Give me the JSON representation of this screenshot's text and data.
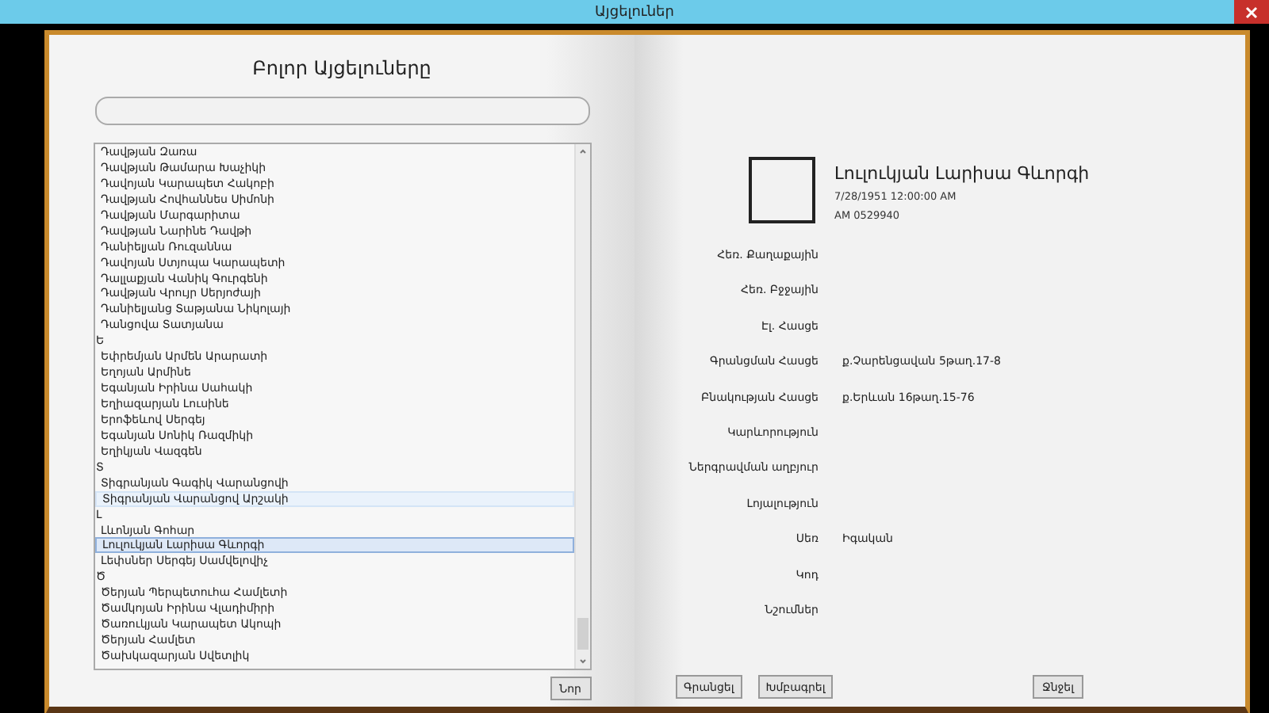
{
  "window": {
    "title": "Այցելուներ"
  },
  "left_page": {
    "heading": "Բոլոր Այցելուները",
    "list": [
      {
        "kind": "entry",
        "text": "Դավթյան Զառա",
        "selected": false,
        "highlighted": false
      },
      {
        "kind": "entry",
        "text": "Դավթյան Թամարա Խաչիկի",
        "selected": false,
        "highlighted": false
      },
      {
        "kind": "entry",
        "text": "Դավոյան Կարապետ Հակոբի",
        "selected": false,
        "highlighted": false
      },
      {
        "kind": "entry",
        "text": "Դավթյան Հովհաննես Սիմոնի",
        "selected": false,
        "highlighted": false
      },
      {
        "kind": "entry",
        "text": "Դավթյան Մարգարիտա",
        "selected": false,
        "highlighted": false
      },
      {
        "kind": "entry",
        "text": "Դավթյան Նարինե Դավթի",
        "selected": false,
        "highlighted": false
      },
      {
        "kind": "entry",
        "text": "Դանիելյան Ռուզաննա",
        "selected": false,
        "highlighted": false
      },
      {
        "kind": "entry",
        "text": "Դավոյան Ստյոպա Կարապետի",
        "selected": false,
        "highlighted": false
      },
      {
        "kind": "entry",
        "text": "Դալլաքյան Վանիկ Գուրգենի",
        "selected": false,
        "highlighted": false
      },
      {
        "kind": "entry",
        "text": "Դավթյան Վրույր Սերյոժայի",
        "selected": false,
        "highlighted": false
      },
      {
        "kind": "entry",
        "text": "Դանիելյանց Տաթյանա Նիկոլայի",
        "selected": false,
        "highlighted": false
      },
      {
        "kind": "entry",
        "text": "Դանցովա Տատյանա",
        "selected": false,
        "highlighted": false
      },
      {
        "kind": "header",
        "text": "Ե",
        "selected": false,
        "highlighted": false
      },
      {
        "kind": "entry",
        "text": "Եփրեմյան Արմեն Արարատի",
        "selected": false,
        "highlighted": false
      },
      {
        "kind": "entry",
        "text": "Եղոյան Արմինե",
        "selected": false,
        "highlighted": false
      },
      {
        "kind": "entry",
        "text": "Եգանյան Իրինա Սահակի",
        "selected": false,
        "highlighted": false
      },
      {
        "kind": "entry",
        "text": "Եղիազարյան Լուսինե",
        "selected": false,
        "highlighted": false
      },
      {
        "kind": "entry",
        "text": "Երոֆեևով Սերգեյ",
        "selected": false,
        "highlighted": false
      },
      {
        "kind": "entry",
        "text": "Եգանյան Սոնիկ Ռազմիկի",
        "selected": false,
        "highlighted": false
      },
      {
        "kind": "entry",
        "text": "Եղիկյան Վազգեն",
        "selected": false,
        "highlighted": false
      },
      {
        "kind": "header",
        "text": "Տ",
        "selected": false,
        "highlighted": false
      },
      {
        "kind": "entry",
        "text": "Տիգրանյան  Գագիկ Վարանցովի",
        "selected": false,
        "highlighted": false
      },
      {
        "kind": "entry",
        "text": "Տիգրանյան Վարանցով Արշակի",
        "selected": false,
        "highlighted": true
      },
      {
        "kind": "header",
        "text": "Լ",
        "selected": false,
        "highlighted": false
      },
      {
        "kind": "entry",
        "text": "Լևոնյան Գոհար",
        "selected": false,
        "highlighted": false
      },
      {
        "kind": "entry",
        "text": "Լուլուկյան Լարիսա Գևորգի",
        "selected": true,
        "highlighted": false
      },
      {
        "kind": "entry",
        "text": "Լեփսներ  Սերգեյ Սամվելովիչ",
        "selected": false,
        "highlighted": false
      },
      {
        "kind": "header",
        "text": "Ծ",
        "selected": false,
        "highlighted": false
      },
      {
        "kind": "entry",
        "text": "Ծերյան Պերպետուհա Համլետի",
        "selected": false,
        "highlighted": false
      },
      {
        "kind": "entry",
        "text": "Ծամկոյան Իրինա Վլադիմիրի",
        "selected": false,
        "highlighted": false
      },
      {
        "kind": "entry",
        "text": "Ծառուկյան Կարապետ Ակոպի",
        "selected": false,
        "highlighted": false
      },
      {
        "kind": "entry",
        "text": "Ծերյան Համլետ",
        "selected": false,
        "highlighted": false
      },
      {
        "kind": "entry",
        "text": "Ծախկազարյան Սվետլիկ",
        "selected": false,
        "highlighted": false
      }
    ],
    "new_button": "Նոր"
  },
  "right_page": {
    "name": "Լուլուկյան Լարիսա Գևորգի",
    "birth_date": "7/28/1951 12:00:00 AM",
    "passport": "AM  0529940",
    "fields": [
      {
        "label": "Հեռ. Քաղաքային"
      },
      {
        "label": "Հեռ. Բջջային"
      },
      {
        "label": "Էլ. Հասցե"
      },
      {
        "label": "Գրանցման Հասցե",
        "value": "ք.Չարենցավան 5թաղ.17-8"
      },
      {
        "label": "Բնակության Հասցե",
        "value": "ք.Երևան 16թաղ.15-76"
      },
      {
        "label": "Կարևորություն"
      },
      {
        "label": "Ներգրավման աղբյուր"
      },
      {
        "label": "Լոյալություն"
      },
      {
        "label": "Սեռ",
        "value": "Իգական"
      },
      {
        "label": "Կոդ"
      },
      {
        "label": "Նշումներ"
      }
    ],
    "buttons": [
      "Գրանցել",
      "Խմբագրել",
      "Ջնջել"
    ]
  }
}
